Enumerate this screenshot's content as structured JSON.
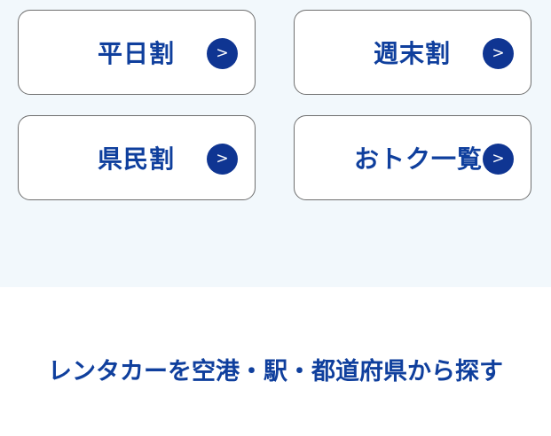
{
  "discounts": {
    "cards": [
      {
        "label": "平日割",
        "arrow": ">"
      },
      {
        "label": "週末割",
        "arrow": ">"
      },
      {
        "label": "県民割",
        "arrow": ">"
      },
      {
        "label": "おトク一覧",
        "arrow": ">"
      }
    ]
  },
  "search_section": {
    "heading": "レンタカーを空港・駅・都道府県から探す"
  },
  "colors": {
    "brand_blue": "#0f3f9d",
    "arrow_bg": "#0f3592",
    "section_bg": "#f2f8fc",
    "card_border": "#6f6f6f"
  }
}
